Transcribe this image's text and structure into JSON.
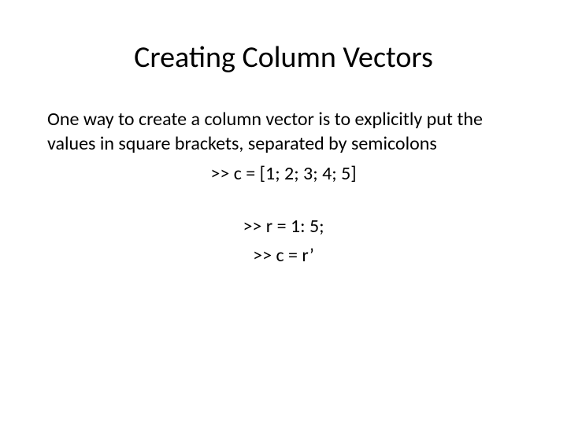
{
  "title": "Creating Column Vectors",
  "paragraph": "One  way to  create a column  vector is to  explicitly put  the  values in square brackets, separated  by semicolons",
  "code1": ">> c = [1; 2; 3; 4; 5]",
  "code2": ">> r = 1: 5;",
  "code3": ">> c = r’"
}
